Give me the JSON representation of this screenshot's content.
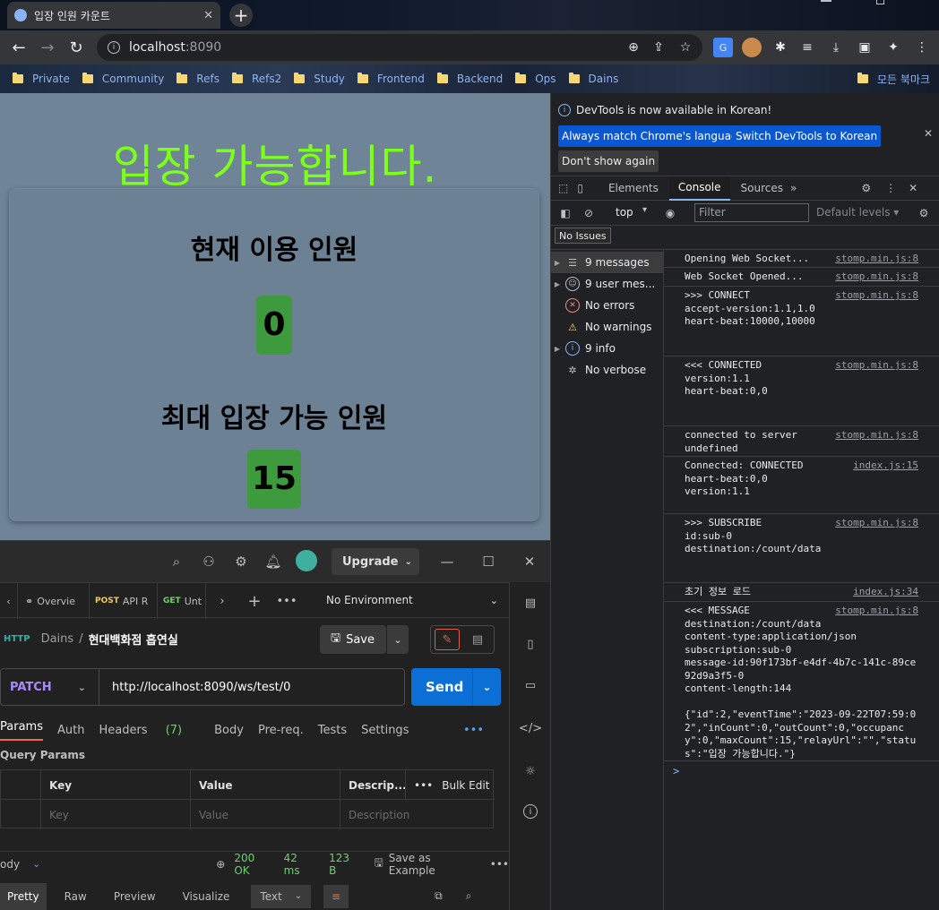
{
  "browser": {
    "tab_title": "입장 인원 카운트",
    "url_host": "localhost",
    "url_port": ":8090",
    "bookmarks": [
      "Private",
      "Community",
      "Refs",
      "Refs2",
      "Study",
      "Frontend",
      "Backend",
      "Ops",
      "Dains"
    ],
    "all_bookmarks": "모든 북마크"
  },
  "page": {
    "title": "입장 가능합니다.",
    "current_label": "현재 이용 인원",
    "current_value": "0",
    "max_label": "최대 입장 가능 인원",
    "max_value": "15"
  },
  "postman": {
    "upgrade": "Upgrade",
    "tabs": [
      {
        "method": "",
        "label": "Overvie"
      },
      {
        "method": "POST",
        "label": "API R"
      },
      {
        "method": "GET",
        "label": "Unt"
      }
    ],
    "environment": "No Environment",
    "crumb_parent": "Dains",
    "crumb_sep": "/",
    "crumb_name": "현대백화점 흡연실",
    "save": "Save",
    "method": "PATCH",
    "url": "http://localhost:8090/ws/test/0",
    "send": "Send",
    "req_tabs": {
      "params": "Params",
      "auth": "Auth",
      "headers": "Headers",
      "headers_count": "(7)",
      "body": "Body",
      "prereq": "Pre-req.",
      "tests": "Tests",
      "settings": "Settings"
    },
    "query_params": "Query Params",
    "table": {
      "key": "Key",
      "value": "Value",
      "description": "Descrip...",
      "bulk": "Bulk Edit",
      "key_ph": "Key",
      "value_ph": "Value",
      "desc_ph": "Description"
    },
    "response": {
      "body": "ody",
      "status": "200 OK",
      "time": "42 ms",
      "size": "123 B",
      "save_example": "Save as Example"
    },
    "bottom": {
      "pretty": "Pretty",
      "raw": "Raw",
      "preview": "Preview",
      "visualize": "Visualize",
      "text": "Text"
    }
  },
  "devtools": {
    "banner": "DevTools is now available in Korean!",
    "btn_match": "Always match Chrome's language",
    "btn_switch": "Switch DevTools to Korean",
    "btn_dont": "Don't show again",
    "panels": [
      "Elements",
      "Console",
      "Sources"
    ],
    "context": "top",
    "filter_placeholder": "Filter",
    "levels": "Default levels",
    "issues": "No Issues",
    "filters": [
      {
        "label": "9 messages",
        "icon": "list-icon"
      },
      {
        "label": "9 user mes...",
        "icon": "user-icon"
      },
      {
        "label": "No errors",
        "icon": "error-icon"
      },
      {
        "label": "No warnings",
        "icon": "warning-icon"
      },
      {
        "label": "9 info",
        "icon": "info-icon"
      },
      {
        "label": "No verbose",
        "icon": "bug-icon"
      }
    ],
    "logs": [
      {
        "text": "Opening Web Socket...",
        "src": "stomp.min.js:8"
      },
      {
        "text": "Web Socket Opened...",
        "src": "stomp.min.js:8"
      },
      {
        "text": ">>> CONNECT\naccept-version:1.1,1.0\nheart-beat:10000,10000",
        "src": "stomp.min.js:8"
      },
      {
        "text": "<<< CONNECTED\nversion:1.1\nheart-beat:0,0",
        "src": "stomp.min.js:8"
      },
      {
        "text": "connected to server\nundefined",
        "src": "stomp.min.js:8"
      },
      {
        "text": "Connected: CONNECTED\nheart-beat:0,0\nversion:1.1",
        "src": "index.js:15"
      },
      {
        "text": ">>> SUBSCRIBE\nid:sub-0\ndestination:/count/data",
        "src": "stomp.min.js:8"
      },
      {
        "text": "초기 정보 로드",
        "src": "index.js:34"
      },
      {
        "text": "<<< MESSAGE\ndestination:/count/data\ncontent-type:application/json\nsubscription:sub-0\nmessage-id:90f173bf-e4df-4b7c-141c-89ce92d9a3f5-0\ncontent-length:144\n\n{\"id\":2,\"eventTime\":\"2023-09-22T07:59:02\",\"inCount\":0,\"outCount\":0,\"occupancy\":0,\"maxCount\":15,\"relayUrl\":\"\",\"status\":\"입장 가능합니다.\"}",
        "src": "stomp.min.js:8"
      }
    ],
    "prompt": ">"
  },
  "colors": {
    "title_green": "#7cff1a",
    "count_green": "#3d9b3d",
    "page_bg": "#6f8497",
    "send_blue": "#0c6fd6"
  }
}
